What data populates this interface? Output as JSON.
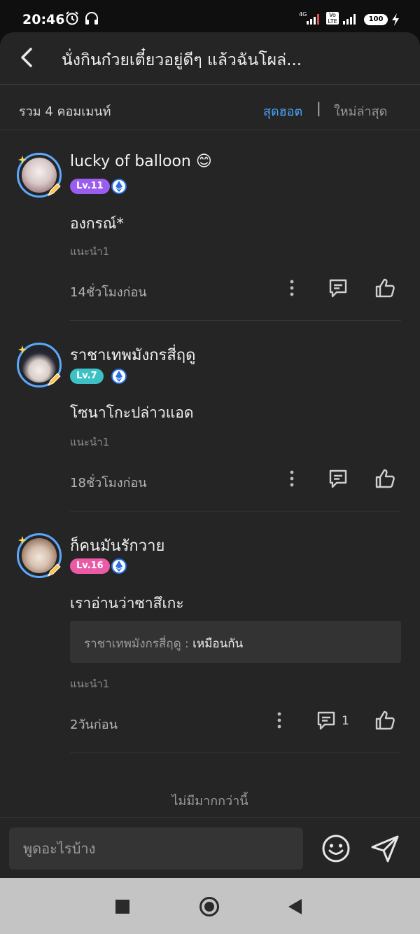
{
  "status_bar": {
    "time": "20:46",
    "net_4g": "4G",
    "volte": "Vo LTE",
    "battery": "100"
  },
  "header": {
    "title": "นั่งกินก๋วยเตี๋ยวอยู่ดีๆ แล้วฉันโผล่..."
  },
  "sortbar": {
    "count_label": "รวม 4 คอมเมนท์",
    "hot_label": "สุดฮอต",
    "separator": "|",
    "new_label": "ใหม่ล่าสุด"
  },
  "comments": [
    {
      "username": "lucky of balloon 😊",
      "level": "Lv.11",
      "level_color": "#9b5cf0",
      "text": "องกรณ์*",
      "recommend": "แนะนำ1",
      "time": "14ชั่วโมงก่อน"
    },
    {
      "username": "ราชาเทพมังกรสี่ฤดู",
      "level": "Lv.7",
      "level_color": "#3ec1c4",
      "text": "โซนาโกะปล่าวแอด",
      "recommend": "แนะนำ1",
      "time": "18ชั่วโมงก่อน"
    },
    {
      "username": "ก็คนมันรักวาย",
      "level": "Lv.16",
      "level_color": "#ea5aa7",
      "text": "เราอ่านว่าซาสึเกะ",
      "reply": {
        "name": "ราชาเทพมังกรสี่ฤดู : ",
        "text": "เหมือนกัน"
      },
      "recommend": "แนะนำ1",
      "time": "2วันก่อน",
      "reply_count": "1"
    }
  ],
  "footer_note": "ไม่มีมากกว่านี้",
  "input": {
    "placeholder": "พูดอะไรบ้าง"
  },
  "icons": {
    "back": "chevron-left-icon",
    "more": "more-vertical-icon",
    "reply": "comment-icon",
    "like": "thumbs-up-icon",
    "emoji": "smiley-icon",
    "send": "send-icon",
    "badge": "ethereum-icon"
  },
  "colors": {
    "accent": "#4aa6ff",
    "sheet_bg": "#252525"
  }
}
